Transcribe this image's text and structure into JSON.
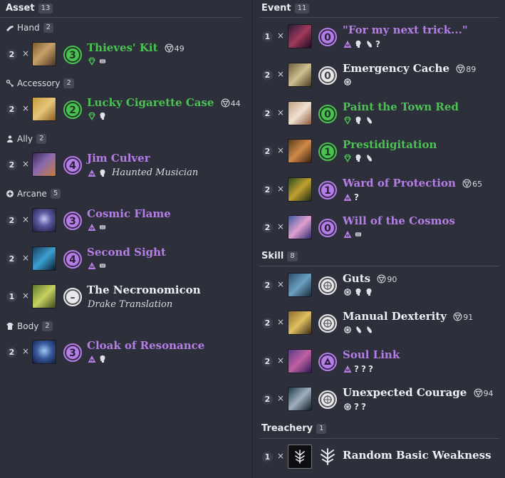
{
  "asset": {
    "title": "Asset",
    "count": "13",
    "hand": {
      "label": "Hand",
      "count": "2",
      "cards": [
        {
          "qty": "2",
          "times": "×",
          "cost": "3",
          "name": "Thieves' Kit",
          "xp": "49"
        }
      ]
    },
    "accessory": {
      "label": "Accessory",
      "count": "2",
      "cards": [
        {
          "qty": "2",
          "times": "×",
          "cost": "2",
          "name": "Lucky Cigarette Case",
          "xp": "44"
        }
      ]
    },
    "ally": {
      "label": "Ally",
      "count": "2",
      "cards": [
        {
          "qty": "2",
          "times": "×",
          "cost": "4",
          "name": "Jim Culver",
          "subname": "Haunted Musician"
        }
      ]
    },
    "arcane": {
      "label": "Arcane",
      "count": "5",
      "cards": [
        {
          "qty": "2",
          "times": "×",
          "cost": "3",
          "name": "Cosmic Flame"
        },
        {
          "qty": "2",
          "times": "×",
          "cost": "4",
          "name": "Second Sight"
        },
        {
          "qty": "1",
          "times": "×",
          "cost": "–",
          "name": "The Necronomicon",
          "subname": "Drake Translation"
        }
      ]
    },
    "body": {
      "label": "Body",
      "count": "2",
      "cards": [
        {
          "qty": "2",
          "times": "×",
          "cost": "3",
          "name": "Cloak of Resonance"
        }
      ]
    }
  },
  "event": {
    "title": "Event",
    "count": "11",
    "cards": [
      {
        "qty": "1",
        "times": "×",
        "cost": "0",
        "name": "\"For my next trick...\"",
        "q": "?"
      },
      {
        "qty": "2",
        "times": "×",
        "cost": "0",
        "name": "Emergency Cache",
        "xp": "89"
      },
      {
        "qty": "2",
        "times": "×",
        "cost": "0",
        "name": "Paint the Town Red"
      },
      {
        "qty": "2",
        "times": "×",
        "cost": "1",
        "name": "Prestidigitation"
      },
      {
        "qty": "2",
        "times": "×",
        "cost": "1",
        "name": "Ward of Protection",
        "xp": "65",
        "q": "?"
      },
      {
        "qty": "2",
        "times": "×",
        "cost": "0",
        "name": "Will of the Cosmos"
      }
    ]
  },
  "skill": {
    "title": "Skill",
    "count": "8",
    "cards": [
      {
        "qty": "2",
        "times": "×",
        "name": "Guts",
        "xp": "90"
      },
      {
        "qty": "2",
        "times": "×",
        "name": "Manual Dexterity",
        "xp": "91"
      },
      {
        "qty": "2",
        "times": "×",
        "name": "Soul Link",
        "q1": "?",
        "q2": "?",
        "q3": "?"
      },
      {
        "qty": "2",
        "times": "×",
        "name": "Unexpected Courage",
        "xp": "94",
        "q1": "?",
        "q2": "?"
      }
    ]
  },
  "treachery": {
    "title": "Treachery",
    "count": "1",
    "cards": [
      {
        "qty": "1",
        "times": "×",
        "name": "Random Basic Weakness"
      }
    ]
  },
  "colors": {
    "rogue": "#4cc153",
    "mystic": "#b57ee6",
    "neutral": "#f0f0f4",
    "background": "#2d303a"
  }
}
